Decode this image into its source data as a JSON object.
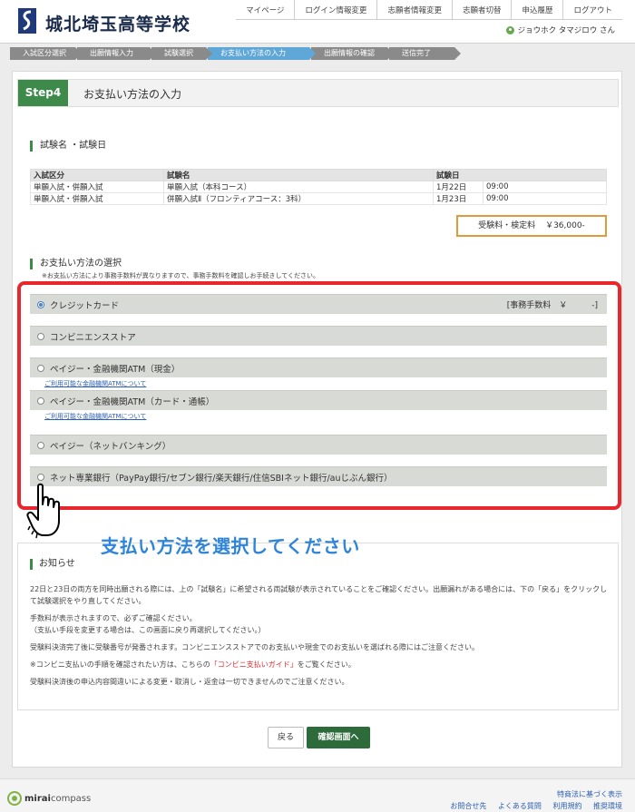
{
  "header": {
    "school_name": "城北埼玉高等学校",
    "nav": [
      "マイページ",
      "ログイン情報変更",
      "志願者情報変更",
      "志願者切替",
      "申込履歴",
      "ログアウト"
    ],
    "user_name": "ジョウホク タマジロウ さん"
  },
  "steps": [
    "入試区分選択",
    "出願情報入力",
    "試験選択",
    "お支払い方法の入力",
    "出願情報の確認",
    "送信完了"
  ],
  "active_step_index": 3,
  "page": {
    "step_badge": "Step4",
    "step_title": "お支払い方法の入力"
  },
  "exam_section": {
    "title": "試験名 ・試験日",
    "headers": [
      "入試区分",
      "試験名",
      "試験日"
    ],
    "rows": [
      [
        "単願入試・併願入試",
        "単願入試（本科コース）",
        "1月22日",
        "09:00"
      ],
      [
        "単願入試・併願入試",
        "併願入試Ⅱ（フロンティアコース：3科）",
        "1月23日",
        "09:00"
      ]
    ],
    "fee_label": "受験料・検定料",
    "fee_value": "￥36,000-"
  },
  "payment_section": {
    "title": "お支払い方法の選択",
    "note": "※お支払い方法により事務手数料が異なりますので、事務手数料を確認しお手続きしてください。",
    "methods": [
      {
        "label": "クレジットカード",
        "checked": true,
        "fee": "[事務手数料　￥　　　-]"
      },
      {
        "label": "コンビニエンスストア",
        "checked": false
      },
      {
        "label": "ペイジー・金融機関ATM（現金）",
        "checked": false,
        "link": "ご利用可能な金融機関ATMについて"
      },
      {
        "label": "ペイジー・金融機関ATM（カード・通帳）",
        "checked": false,
        "link": "ご利用可能な金融機関ATMについて"
      },
      {
        "label": "ペイジー（ネットバンキング）",
        "checked": false
      },
      {
        "label": "ネット専業銀行（PayPay銀行/セブン銀行/楽天銀行/住信SBIネット銀行/auじぶん銀行）",
        "checked": false
      }
    ]
  },
  "overlay_text": "支払い方法を選択してください",
  "notice": {
    "title": "お知らせ",
    "p1": "22日と23日の両方を同時出願される際には、上の「試験名」に希望される両試験が表示されていることをご確認ください。出願漏れがある場合には、下の「戻る」をクリックして試験選択をやり直してください。",
    "p2a": "手数料が表示されますので、必ずご確認ください。",
    "p2b": "（支払い手段を変更する場合は、この画面に戻り再選択してください。）",
    "p3": "受験料決済完了後に受験番号が発番されます。コンビニエンスストアでのお支払いや現金でのお支払いを選ばれる際にはご注意ください。",
    "p4_pre": "※コンビニ支払いの手順を確認されたい方は、こちらの",
    "p4_link": "「コンビニ支払いガイド」",
    "p4_post": "をご覧ください。",
    "p5": "受験料決済後の申込内容間違いによる変更・取消し・返金は一切できませんのでご注意ください。"
  },
  "buttons": {
    "back": "戻る",
    "confirm": "確認画面へ"
  },
  "footer": {
    "brand_a": "mirai",
    "brand_b": "compass",
    "links_row1": [
      "特商法に基づく表示"
    ],
    "links_row2": [
      "お問合せ先",
      "よくある質問",
      "利用規約",
      "推奨環境"
    ]
  }
}
